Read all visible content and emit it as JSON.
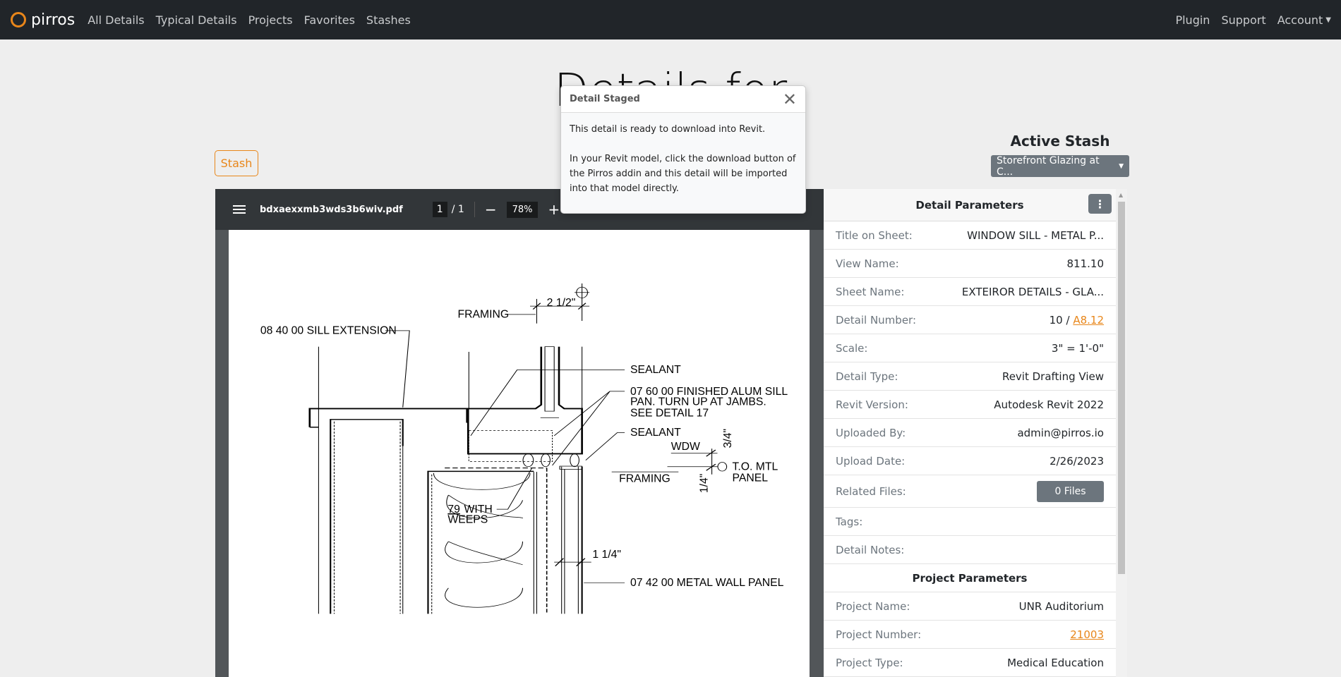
{
  "brand": "pirros",
  "nav": {
    "items": [
      "All Details",
      "Typical Details",
      "Projects",
      "Favorites",
      "Stashes"
    ],
    "right": [
      "Plugin",
      "Support",
      "Account"
    ]
  },
  "page_title": "Details for",
  "stash_button": "Stash",
  "active_stash": {
    "heading": "Active Stash",
    "selected": "Storefront Glazing at C..."
  },
  "viewer": {
    "filename": "bdxaexxmb3wds3b6wiv.pdf",
    "page": "1",
    "total_pages": "1",
    "zoom": "78%"
  },
  "drawing_labels": {
    "framing_top": "FRAMING",
    "dim_2_1_2": "2 1/2\"",
    "sill_ext": "08 40 00  SILL EXTENSION",
    "sealant1": "SEALANT",
    "pan1": "07 60 00  FINISHED ALUM SILL",
    "pan2": "PAN. TURN UP AT JAMBS.",
    "pan3": "SEE DETAIL 17",
    "sealant2": "SEALANT",
    "wdw": "WDW",
    "dim_3_4": "3/4\"",
    "to_mtl": "T.O. MTL",
    "panel": "PANEL",
    "framing_right": "FRAMING",
    "dim_1_4": "1/4\"",
    "weeps_num": "79",
    "weeps1": "WITH",
    "weeps2": "WEEPS",
    "dim_1_1_4": "1 1/4\"",
    "metal_panel": "07 42 00  METAL WALL PANEL"
  },
  "detail_parameters": {
    "heading": "Detail Parameters",
    "rows": [
      {
        "label": "Title on Sheet:",
        "value": "WINDOW SILL - METAL P..."
      },
      {
        "label": "View Name:",
        "value": "811.10"
      },
      {
        "label": "Sheet Name:",
        "value": "EXTEIROR DETAILS - GLA..."
      },
      {
        "label": "Detail Number:",
        "value": "10 / ",
        "link": "A8.12"
      },
      {
        "label": "Scale:",
        "value": "3\" = 1'-0\""
      },
      {
        "label": "Detail Type:",
        "value": "Revit Drafting View"
      },
      {
        "label": "Revit Version:",
        "value": "Autodesk Revit 2022"
      },
      {
        "label": "Uploaded By:",
        "value": "admin@pirros.io"
      },
      {
        "label": "Upload Date:",
        "value": "2/26/2023"
      },
      {
        "label": "Related Files:",
        "button": "0 Files"
      },
      {
        "label": "Tags:"
      },
      {
        "label": "Detail Notes:"
      }
    ]
  },
  "project_parameters": {
    "heading": "Project Parameters",
    "rows": [
      {
        "label": "Project Name:",
        "value": "UNR Auditorium"
      },
      {
        "label": "Project Number:",
        "link": "21003"
      },
      {
        "label": "Project Type:",
        "value": "Medical Education"
      }
    ]
  },
  "toast": {
    "title": "Detail Staged",
    "line1": "This detail is ready to download into Revit.",
    "line2": "In your Revit model, click the download button of the Pirros addin and this detail will be imported into that model directly."
  },
  "colors": {
    "accent": "#e8861a",
    "navbar": "#212529",
    "secondary": "#6c757d"
  }
}
